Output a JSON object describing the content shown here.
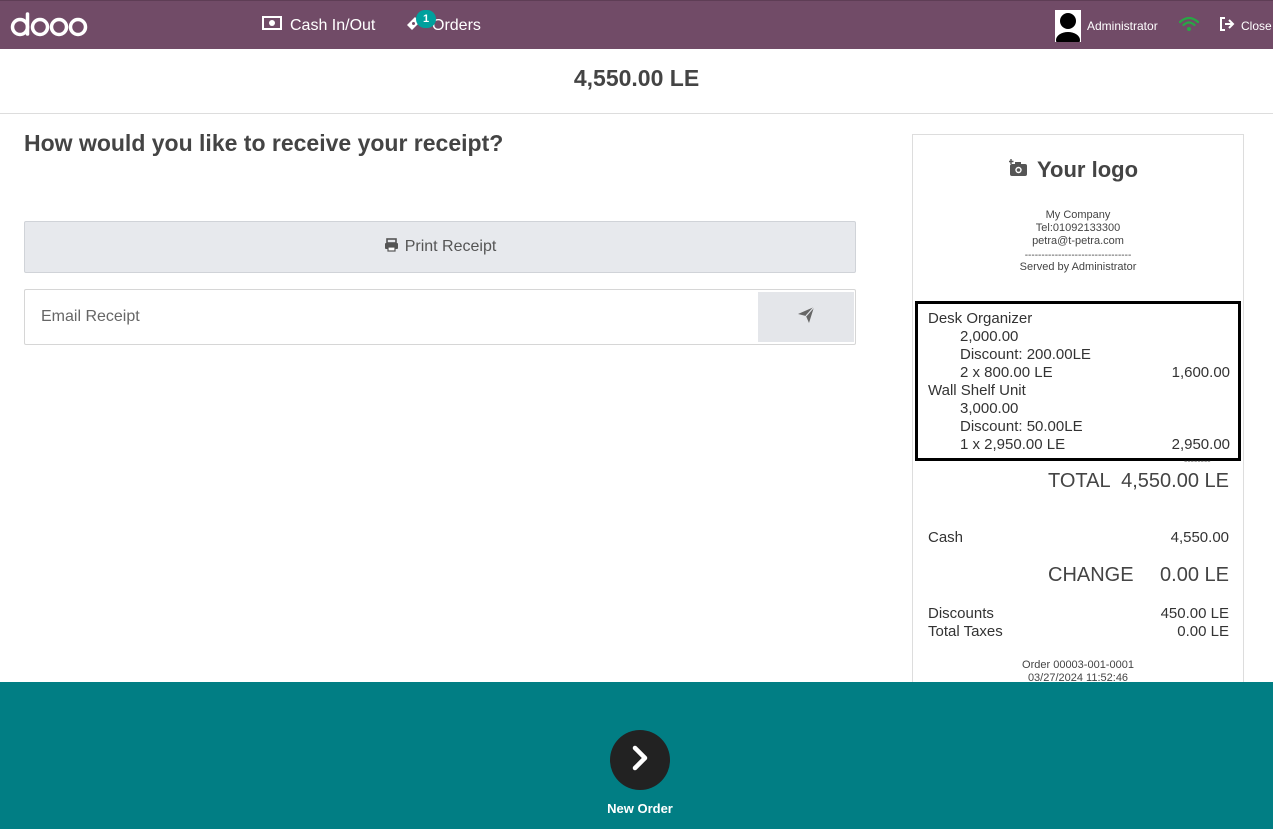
{
  "navbar": {
    "logo_text": "odoo",
    "cash_label": "Cash In/Out",
    "orders_label": "Orders",
    "orders_badge": "1",
    "user_label": "Administrator",
    "close_label": "Close",
    "colors": {
      "bar": "#714b67",
      "badge": "#00a09d",
      "wifi": "#28a745"
    }
  },
  "amount": "4,550.00 LE",
  "receipt_prompt": {
    "question": "How would you like to receive your receipt?",
    "print_label": "Print Receipt",
    "email_placeholder": "Email Receipt",
    "email_value": ""
  },
  "receipt": {
    "logo_text": "Your logo",
    "company": "My Company",
    "phone": "Tel:01092133300",
    "email": "petra@t-petra.com",
    "separator": "--------------------------------",
    "served_by": "Served by Administrator",
    "lines": [
      {
        "product": "Desk Organizer",
        "base_price": "2,000.00",
        "discount": "Discount: 200.00LE",
        "qty_price": "2 x 800.00 LE",
        "total": "1,600.00"
      },
      {
        "product": "Wall Shelf Unit",
        "base_price": "3,000.00",
        "discount": "Discount: 50.00LE",
        "qty_price": "1 x 2,950.00 LE",
        "total": "2,950.00"
      }
    ],
    "total_separator": "--------",
    "total_label": "TOTAL",
    "total_value": "4,550.00 LE",
    "payment_method": "Cash",
    "payment_value": "4,550.00",
    "change_label": "CHANGE",
    "change_value": "0.00 LE",
    "discounts_label": "Discounts",
    "discounts_value": "450.00 LE",
    "taxes_label": "Total Taxes",
    "taxes_value": "0.00 LE",
    "order_ref": "Order 00003-001-0001",
    "order_date": "03/27/2024 11:52:46"
  },
  "footer": {
    "next_label": "New Order",
    "colors": {
      "bar": "#017e84",
      "button": "#222222"
    }
  }
}
